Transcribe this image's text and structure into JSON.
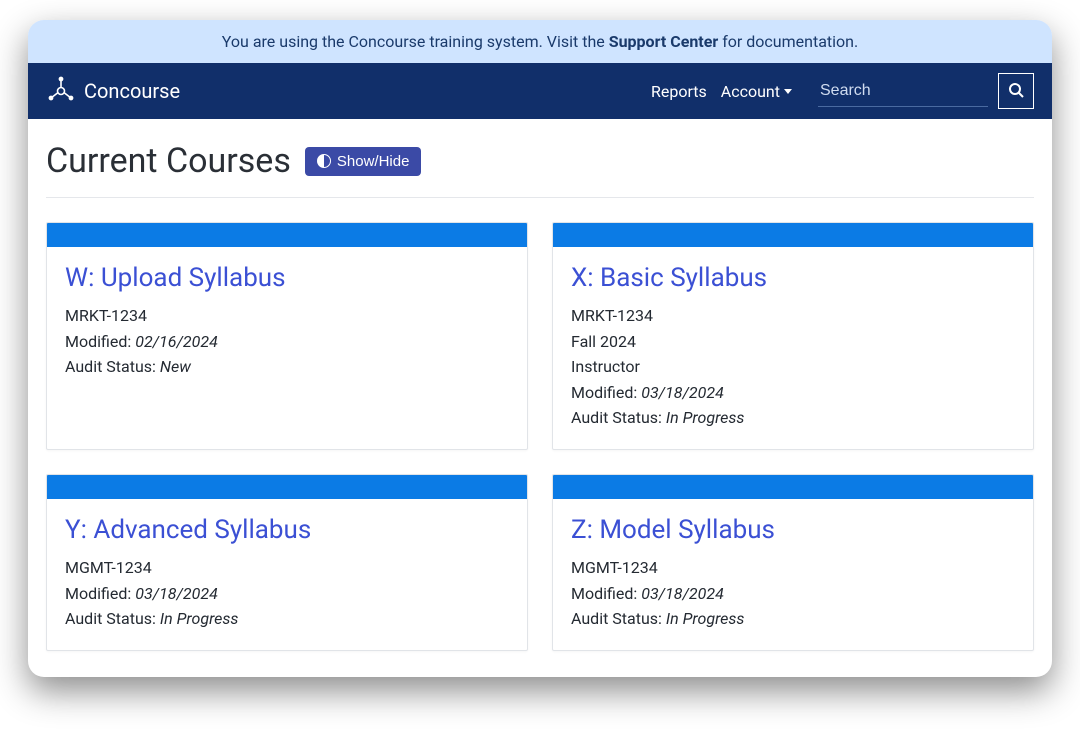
{
  "banner": {
    "prefix": "You are using the Concourse training system. Visit the ",
    "link_text": "Support Center",
    "suffix": " for documentation."
  },
  "nav": {
    "brand": "Concourse",
    "reports": "Reports",
    "account": "Account",
    "search_placeholder": "Search"
  },
  "heading": "Current Courses",
  "showhide": "Show/Hide",
  "labels": {
    "modified_prefix": "Modified: ",
    "audit_prefix": "Audit Status: "
  },
  "courses": [
    {
      "title": "W: Upload Syllabus",
      "code": "MRKT-1234",
      "term": null,
      "role": null,
      "modified": "02/16/2024",
      "audit": "New"
    },
    {
      "title": "X: Basic Syllabus",
      "code": "MRKT-1234",
      "term": "Fall 2024",
      "role": "Instructor",
      "modified": "03/18/2024",
      "audit": "In Progress"
    },
    {
      "title": "Y: Advanced Syllabus",
      "code": "MGMT-1234",
      "term": null,
      "role": null,
      "modified": "03/18/2024",
      "audit": "In Progress"
    },
    {
      "title": "Z: Model Syllabus",
      "code": "MGMT-1234",
      "term": null,
      "role": null,
      "modified": "03/18/2024",
      "audit": "In Progress"
    }
  ]
}
